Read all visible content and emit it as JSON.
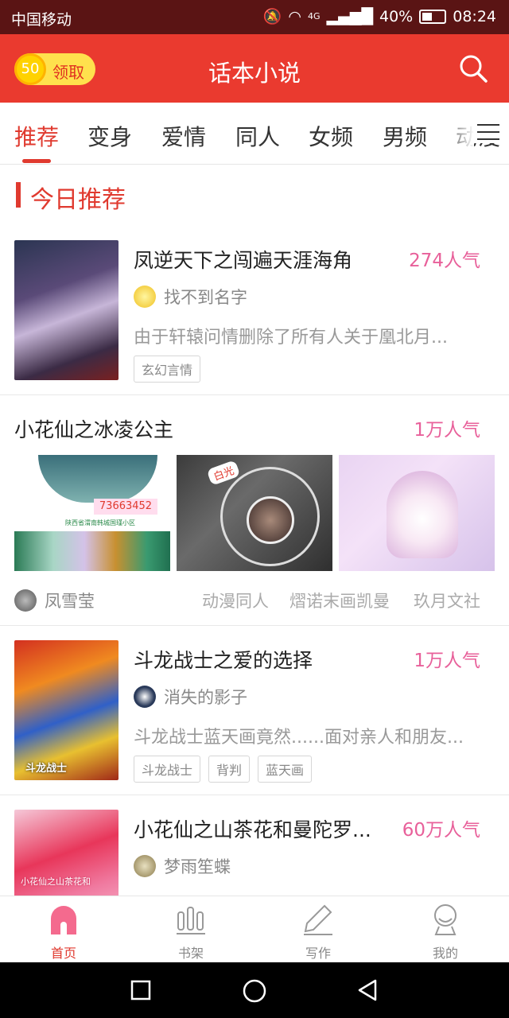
{
  "status_bar": {
    "carrier": "中国移动",
    "signal": "4G",
    "battery": "40%",
    "time": "08:24"
  },
  "app_bar": {
    "coin_value": "50",
    "coin_label": "领取",
    "title": "话本小说",
    "icon": "search-icon"
  },
  "tabs": [
    {
      "label": "推荐",
      "active": true
    },
    {
      "label": "变身"
    },
    {
      "label": "爱情"
    },
    {
      "label": "同人"
    },
    {
      "label": "女频"
    },
    {
      "label": "男频"
    },
    {
      "label": "动漫"
    }
  ],
  "section": {
    "title": "今日推荐"
  },
  "stories": [
    {
      "title": "凤逆天下之闯遍天涯海角",
      "popularity": "274人气",
      "author": "找不到名字",
      "description": "由于轩辕问情删除了所有人关于凰北月...",
      "tags": [
        "玄幻言情"
      ]
    },
    {
      "title": "小花仙之冰凌公主",
      "popularity": "1万人气",
      "author": "凤雪莹",
      "image_number": "73663452",
      "image_caption": "陕西省渭南韩城国瑾小区",
      "image_tag": "白光",
      "tags": [
        "动漫同人",
        "熠诺末画凯曼",
        "玖月文社"
      ]
    },
    {
      "title": "斗龙战士之爱的选择",
      "popularity": "1万人气",
      "author": "消失的影子",
      "description": "斗龙战士蓝天画竟然......面对亲人和朋友...",
      "tags": [
        "斗龙战士",
        "背判",
        "蓝天画"
      ],
      "cover_text": "斗龙战士"
    },
    {
      "title": "小花仙之山茶花和曼陀罗...",
      "popularity": "60万人气",
      "author": "梦雨笙蝶",
      "cover_text": "小花仙之山茶花和"
    }
  ],
  "bottom_nav": [
    {
      "label": "首页",
      "icon": "home-icon",
      "active": true
    },
    {
      "label": "书架",
      "icon": "bookshelf-icon"
    },
    {
      "label": "写作",
      "icon": "pen-icon"
    },
    {
      "label": "我的",
      "icon": "profile-icon"
    }
  ],
  "colors": {
    "primary": "#ea3a2f",
    "popularity": "#e8609a",
    "status_bar": "#5a1414"
  }
}
